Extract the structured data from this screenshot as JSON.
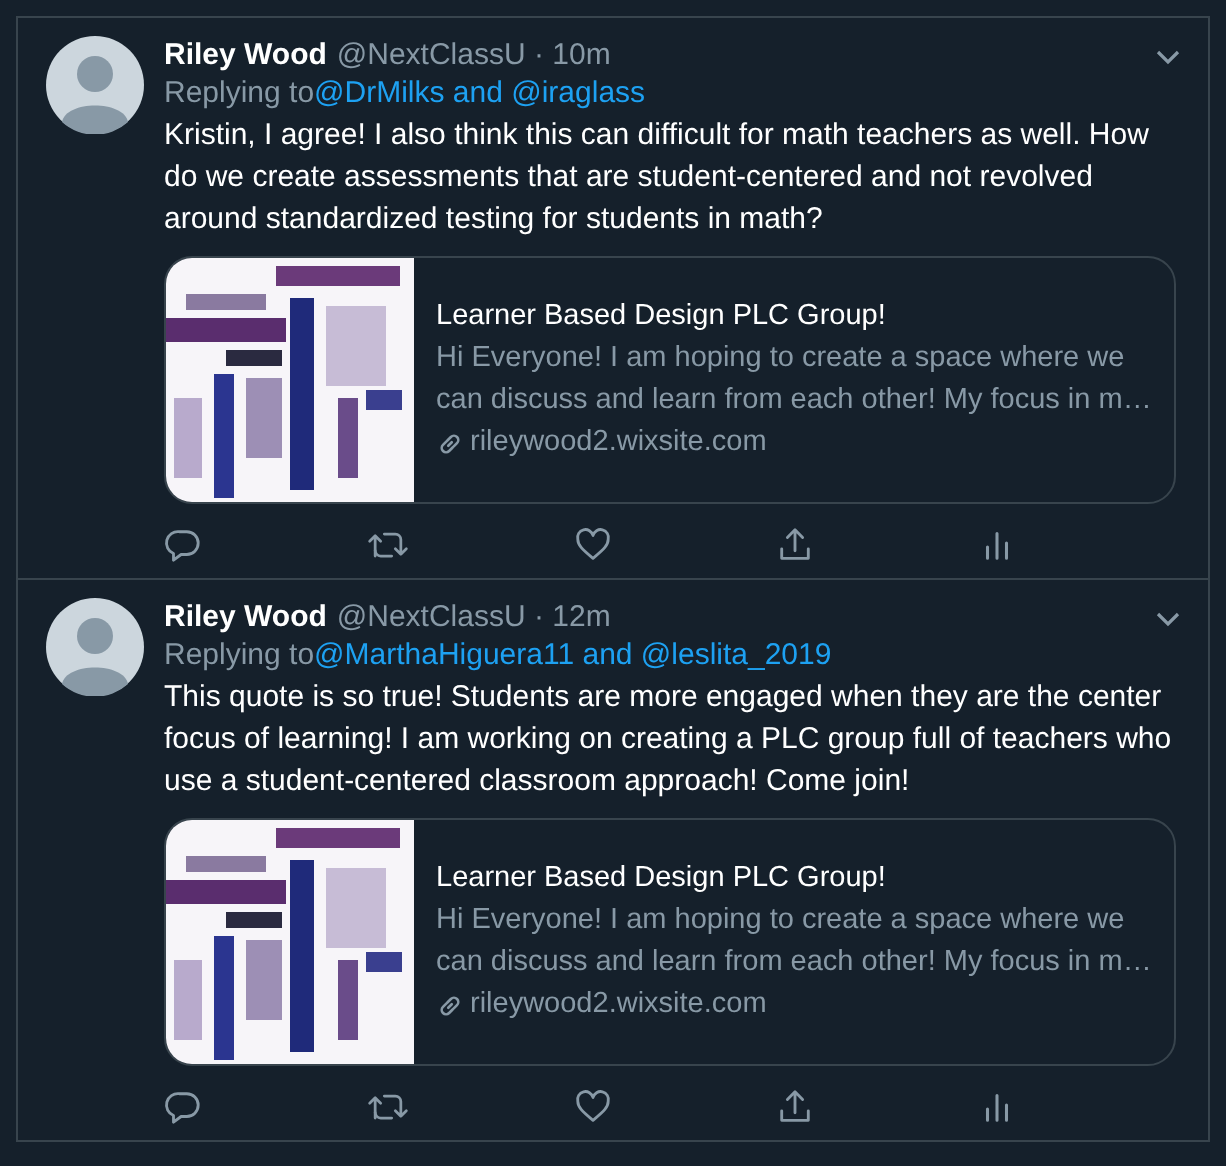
{
  "tweets": [
    {
      "name": "Riley Wood",
      "meta": "@NextClassU · 10m",
      "reply_label": "Replying to",
      "reply_to": "@DrMilks and @iraglass",
      "text": "Kristin, I agree! I also think this can difficult for math teachers as well. How do we create assessments that are student-centered and not revolved around standardized testing for students in math?",
      "card": {
        "kind": "picture",
        "title": "Learner Based Design PLC Group!",
        "description": "Hi Everyone! I am hoping to create a space where we can discuss and learn from each other! My focus in m…",
        "domain": "rileywood2.wixsite.com"
      }
    },
    {
      "name": "Riley Wood",
      "meta": "@NextClassU · 12m",
      "reply_label": "Replying to",
      "reply_to": "@MarthaHiguera11 and @leslita_2019",
      "text": "This quote is so true! Students are more engaged when they are the center focus of learning! I am working on creating a PLC group full of teachers who use a student-centered classroom approach! Come join!",
      "card": {
        "kind": "picture",
        "title": "Learner Based Design PLC Group!",
        "description": "Hi Everyone! I am hoping to create a space where we can discuss and learn from each other! My focus in m…",
        "domain": "rileywood2.wixsite.com"
      }
    }
  ]
}
